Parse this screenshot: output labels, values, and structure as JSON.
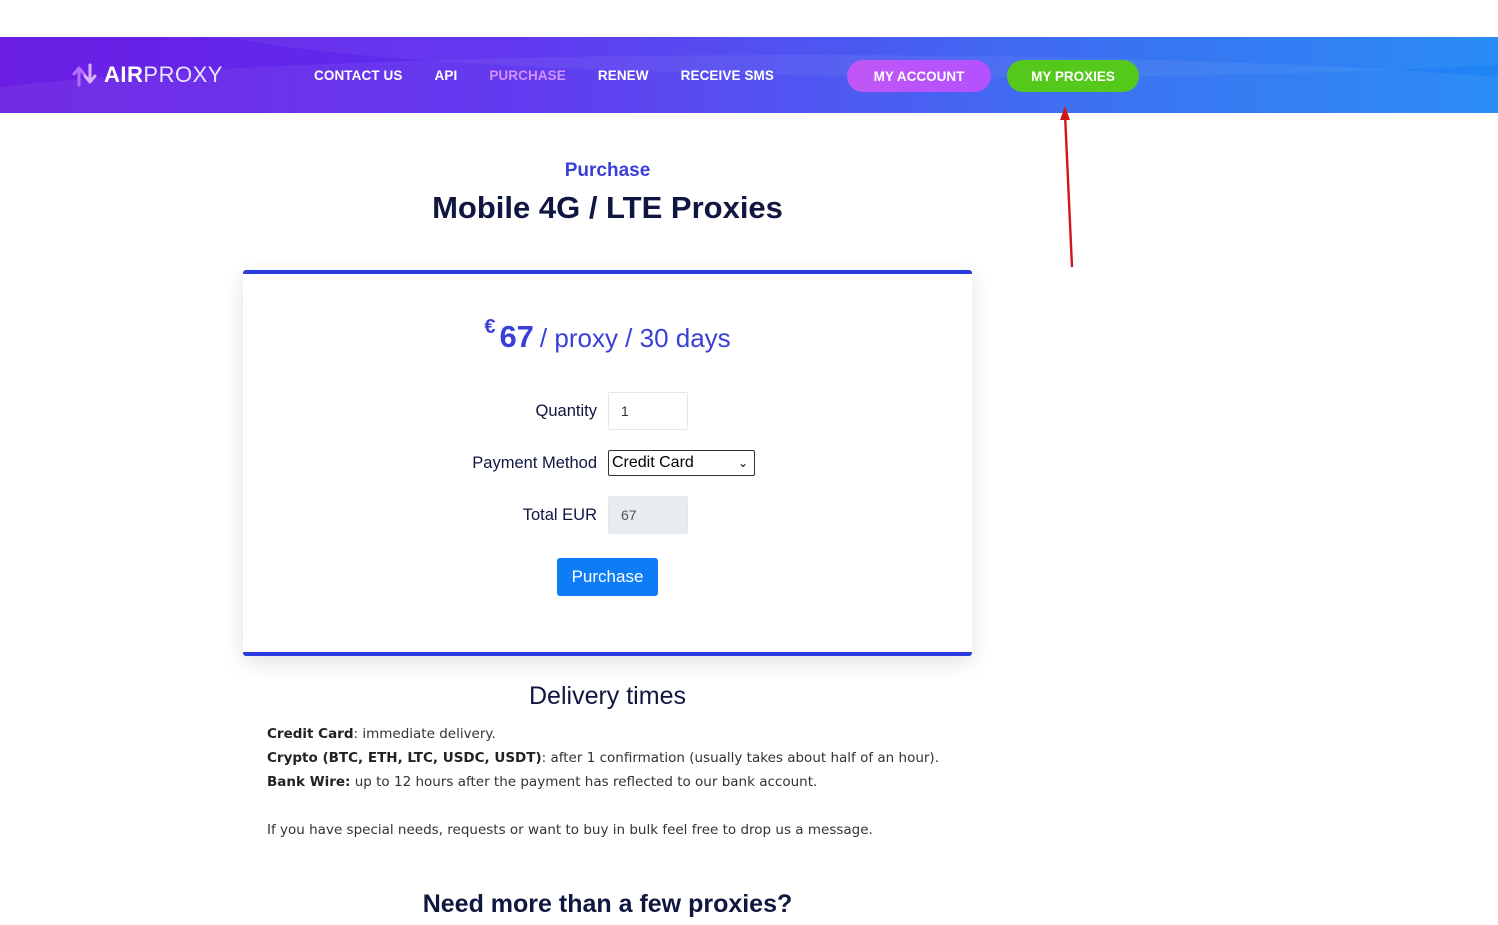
{
  "header": {
    "logo": {
      "bold": "AIR",
      "light": "PROXY"
    },
    "nav": [
      {
        "label": "CONTACT US",
        "active": false
      },
      {
        "label": "API",
        "active": false
      },
      {
        "label": "PURCHASE",
        "active": true
      },
      {
        "label": "RENEW",
        "active": false
      },
      {
        "label": "RECEIVE SMS",
        "active": false
      }
    ],
    "account_button": "MY ACCOUNT",
    "proxies_button": "MY PROXIES"
  },
  "page": {
    "eyebrow": "Purchase",
    "title": "Mobile 4G / LTE Proxies"
  },
  "card": {
    "currency_symbol": "€",
    "price": "67",
    "unit": "/ proxy / 30 days",
    "quantity_label": "Quantity",
    "quantity_value": "1",
    "payment_label": "Payment Method",
    "payment_selected": "Credit Card",
    "total_label": "Total EUR",
    "total_value": "67",
    "purchase_button": "Purchase"
  },
  "delivery": {
    "title": "Delivery times",
    "lines": [
      {
        "label": "Credit Card",
        "text": ": immediate delivery."
      },
      {
        "label": "Crypto (BTC, ETH, LTC, USDC, USDT)",
        "text": ": after 1 confirmation (usually takes about half of an hour)."
      },
      {
        "label": "Bank Wire:",
        "text": " up to 12 hours after the payment has reflected to our bank account."
      }
    ],
    "note": "If you have special needs, requests or want to buy in bulk feel free to drop us a message."
  },
  "bottom_title": "Need more than a few proxies?",
  "colors": {
    "accent": "#3b3fd8",
    "card_border": "#2a3be0",
    "account_button": "#c156f5",
    "proxies_button": "#55c81c",
    "purchase_button": "#0d7cf5",
    "annotation_arrow": "#d0151b"
  }
}
